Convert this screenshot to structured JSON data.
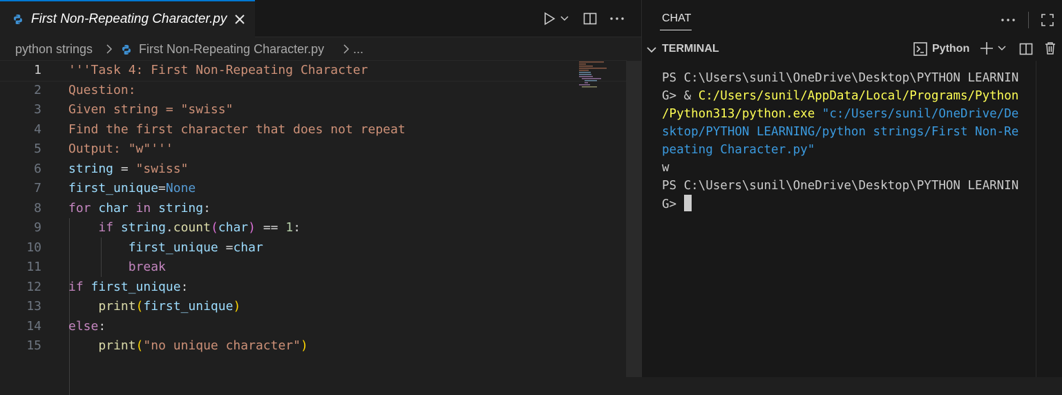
{
  "editor": {
    "tab": {
      "label": "First Non-Repeating Character.py"
    },
    "breadcrumb": {
      "folder": "python strings",
      "file": "First Non-Repeating Character.py",
      "more": "..."
    },
    "lines": [
      {
        "num": "1",
        "tokens": [
          {
            "t": "'''Task 4: First Non-Repeating Character",
            "c": "s"
          }
        ]
      },
      {
        "num": "2",
        "tokens": [
          {
            "t": "Question:",
            "c": "s"
          }
        ]
      },
      {
        "num": "3",
        "tokens": [
          {
            "t": "Given string = \"swiss\"",
            "c": "s"
          }
        ]
      },
      {
        "num": "4",
        "tokens": [
          {
            "t": "Find the first character that does not repeat",
            "c": "s"
          }
        ]
      },
      {
        "num": "5",
        "tokens": [
          {
            "t": "Output: \"w\"'''",
            "c": "s"
          }
        ]
      },
      {
        "num": "6",
        "tokens": [
          {
            "t": "string",
            "c": "v"
          },
          {
            "t": " = ",
            "c": "w"
          },
          {
            "t": "\"swiss\"",
            "c": "s"
          }
        ]
      },
      {
        "num": "7",
        "tokens": [
          {
            "t": "first_unique",
            "c": "v"
          },
          {
            "t": "=",
            "c": "w"
          },
          {
            "t": "None",
            "c": "c"
          }
        ]
      },
      {
        "num": "8",
        "tokens": [
          {
            "t": "for",
            "c": "k"
          },
          {
            "t": " char ",
            "c": "v"
          },
          {
            "t": "in",
            "c": "k"
          },
          {
            "t": " string",
            "c": "v"
          },
          {
            "t": ":",
            "c": "w"
          }
        ]
      },
      {
        "num": "9",
        "tokens": [
          {
            "t": "    ",
            "c": "w"
          },
          {
            "t": "if",
            "c": "k"
          },
          {
            "t": " string",
            "c": "v"
          },
          {
            "t": ".",
            "c": "w"
          },
          {
            "t": "count",
            "c": "f"
          },
          {
            "t": "(",
            "c": "pp"
          },
          {
            "t": "char",
            "c": "v"
          },
          {
            "t": ")",
            "c": "pp"
          },
          {
            "t": " == ",
            "c": "w"
          },
          {
            "t": "1",
            "c": "n"
          },
          {
            "t": ":",
            "c": "w"
          }
        ]
      },
      {
        "num": "10",
        "tokens": [
          {
            "t": "        ",
            "c": "w"
          },
          {
            "t": "first_unique",
            "c": "v"
          },
          {
            "t": " =",
            "c": "w"
          },
          {
            "t": "char",
            "c": "v"
          }
        ]
      },
      {
        "num": "11",
        "tokens": [
          {
            "t": "        ",
            "c": "w"
          },
          {
            "t": "break",
            "c": "k"
          }
        ]
      },
      {
        "num": "12",
        "tokens": [
          {
            "t": "if",
            "c": "k"
          },
          {
            "t": " first_unique",
            "c": "v"
          },
          {
            "t": ":",
            "c": "w"
          }
        ]
      },
      {
        "num": "13",
        "tokens": [
          {
            "t": "    ",
            "c": "w"
          },
          {
            "t": "print",
            "c": "f"
          },
          {
            "t": "(",
            "c": "p"
          },
          {
            "t": "first_unique",
            "c": "v"
          },
          {
            "t": ")",
            "c": "p"
          }
        ]
      },
      {
        "num": "14",
        "tokens": [
          {
            "t": "else",
            "c": "k"
          },
          {
            "t": ":",
            "c": "w"
          }
        ]
      },
      {
        "num": "15",
        "tokens": [
          {
            "t": "    ",
            "c": "w"
          },
          {
            "t": "print",
            "c": "f"
          },
          {
            "t": "(",
            "c": "p"
          },
          {
            "t": "\"no unique character\"",
            "c": "s"
          },
          {
            "t": ")",
            "c": "p"
          }
        ]
      }
    ]
  },
  "panel": {
    "chat_tab": "CHAT",
    "terminal_title": "TERMINAL",
    "shell_label": "Python",
    "terminal_lines": [
      [
        {
          "t": "PS C:\\Users\\sunil\\OneDrive\\Desktop\\PYTHON LEARNIN",
          "c": ""
        }
      ],
      [
        {
          "t": "G> & ",
          "c": ""
        },
        {
          "t": "C:/Users/sunil/AppData/Local/Programs/Python",
          "c": "y"
        }
      ],
      [
        {
          "t": "/Python313/python.exe ",
          "c": "y"
        },
        {
          "t": "\"c:/Users/sunil/OneDrive/De",
          "c": "b"
        }
      ],
      [
        {
          "t": "sktop/PYTHON LEARNING/python strings/First Non-Re",
          "c": "b"
        }
      ],
      [
        {
          "t": "peating Character.py\"",
          "c": "b"
        }
      ],
      [
        {
          "t": "w",
          "c": ""
        }
      ],
      [
        {
          "t": "PS C:\\Users\\sunil\\OneDrive\\Desktop\\PYTHON LEARNIN",
          "c": ""
        }
      ],
      [
        {
          "t": "G> ",
          "c": ""
        }
      ]
    ]
  },
  "icons": [
    "python-file-icon",
    "close-icon",
    "run-icon",
    "chevron-down-icon",
    "split-editor-icon",
    "more-icon",
    "terminal-icon",
    "plus-icon",
    "trash-icon",
    "maximize-icon"
  ]
}
